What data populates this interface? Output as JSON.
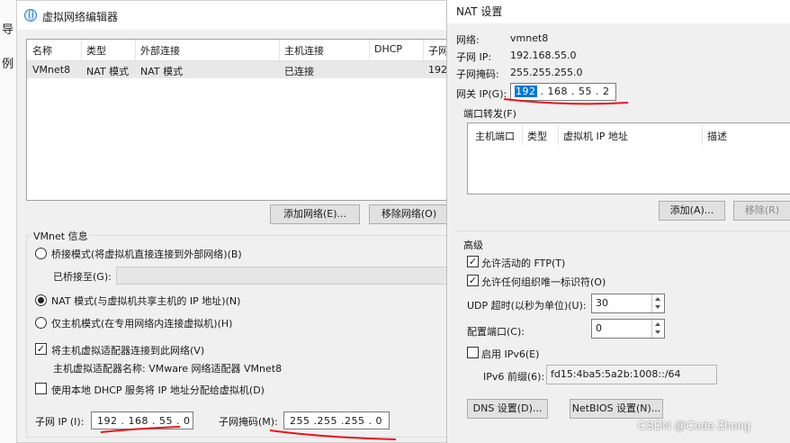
{
  "background": {
    "left_text_1": "导",
    "left_text_2": "例"
  },
  "editor": {
    "title": "虚拟网络编辑器",
    "columns": [
      "名称",
      "类型",
      "外部连接",
      "主机连接",
      "DHCP",
      "子网"
    ],
    "rows": [
      {
        "name": "VMnet8",
        "type": "NAT 模式",
        "external": "NAT 模式",
        "host": "已连接",
        "dhcp": "",
        "subnet": "192."
      }
    ],
    "add_network_button": "添加网络(E)...",
    "remove_network_button": "移除网络(O)",
    "vmnet_info_label": "VMnet 信息",
    "bridged_radio": "桥接模式(将虚拟机直接连接到外部网络)(B)",
    "bridged_to_label": "已桥接至(G):",
    "bridged_to_value": "",
    "nat_radio": "NAT 模式(与虚拟机共享主机的 IP 地址)(N)",
    "hostonly_radio": "仅主机模式(在专用网络内连接虚拟机)(H)",
    "connect_adapter_checkbox": "将主机虚拟适配器连接到此网络(V)",
    "adapter_name_text": "主机虚拟适配器名称: VMware 网络适配器 VMnet8",
    "dhcp_checkbox": "使用本地 DHCP 服务将 IP 地址分配给虚拟机(D)",
    "subnet_ip_label": "子网 IP (I):",
    "subnet_ip_value": "192 . 168 . 55 . 0",
    "subnet_mask_label": "子网掩码(M):",
    "subnet_mask_value": "255 .255 .255 . 0",
    "selected_mode": "nat",
    "connect_adapter_checked": true,
    "dhcp_checked": false
  },
  "nat": {
    "title": "NAT 设置",
    "network_label": "网络:",
    "network_value": "vmnet8",
    "subnet_ip_label": "子网 IP:",
    "subnet_ip_value": "192.168.55.0",
    "subnet_mask_label": "子网掩码:",
    "subnet_mask_value": "255.255.255.0",
    "gateway_label": "网关 IP(G):",
    "gateway_oct1": "192",
    "gateway_rest": " . 168 . 55 . 2",
    "port_forward_label": "端口转发(F)",
    "pf_columns": [
      "主机端口",
      "类型",
      "虚拟机 IP 地址",
      "描述"
    ],
    "add_button": "添加(A)...",
    "remove_button": "移除(R)",
    "advanced_label": "高级",
    "allow_ftp": "允许活动的 FTP(T)",
    "allow_ftp_checked": true,
    "allow_oui": "允许任何组织唯一标识符(O)",
    "allow_oui_checked": true,
    "udp_timeout_label": "UDP 超时(以秒为单位)(U):",
    "udp_timeout_value": "30",
    "config_port_label": "配置端口(C):",
    "config_port_value": "0",
    "enable_ipv6": "启用 IPv6(E)",
    "enable_ipv6_checked": false,
    "ipv6_prefix_label": "IPv6 前缀(6):",
    "ipv6_prefix_value": "fd15:4ba5:5a2b:1008::/64",
    "dns_button": "DNS 设置(D)...",
    "netbios_button": "NetBIOS 设置(N)..."
  },
  "watermark": "CSDN @Code Zhong",
  "annotation_color": "#e8141c"
}
